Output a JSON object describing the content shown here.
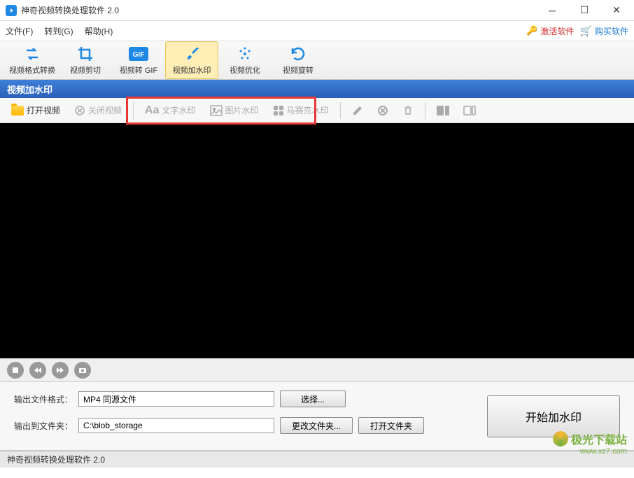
{
  "titlebar": {
    "title": "神奇视频转换处理软件 2.0"
  },
  "menubar": {
    "file": "文件(F)",
    "goto": "转到(G)",
    "help": "帮助(H)",
    "activate": "激活软件",
    "buy": "购买软件"
  },
  "toolbar": {
    "format": "视频格式转换",
    "crop": "视频剪切",
    "gif": "视频转 GIF",
    "watermark": "视频加水印",
    "optimize": "视频优化",
    "rotate": "视频旋转"
  },
  "section": {
    "title": "视频加水印"
  },
  "subtoolbar": {
    "open": "打开视频",
    "close": "关闭视频",
    "text_wm": "文字水印",
    "image_wm": "图片水印",
    "mosaic_wm": "马赛克水印"
  },
  "output": {
    "format_label": "输出文件格式：",
    "format_value": "MP4 同源文件",
    "select_btn": "选择...",
    "folder_label": "输出到文件夹：",
    "folder_value": "C:\\blob_storage",
    "change_btn": "更改文件夹...",
    "open_btn": "打开文件夹",
    "start_btn": "开始加水印"
  },
  "statusbar": {
    "text": "神奇视频转换处理软件 2.0"
  },
  "watermark": {
    "name": "极光下载站",
    "url": "www.xz7.com"
  }
}
